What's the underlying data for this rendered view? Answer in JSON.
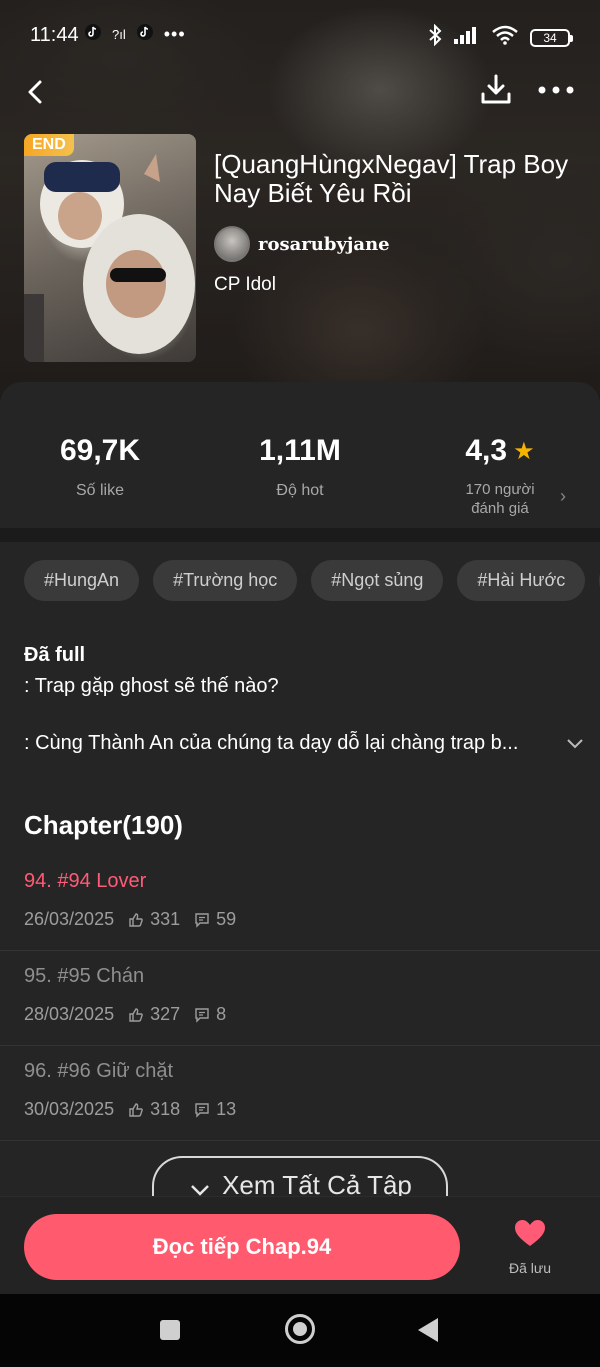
{
  "status": {
    "time": "11:44",
    "left_icons": [
      "tiktok-icon",
      "signal-question-icon",
      "tiktok-icon",
      "more-dots-icon"
    ],
    "right_icons": [
      "bluetooth-icon",
      "signal-icon",
      "wifi-icon"
    ],
    "battery": "34"
  },
  "cover": {
    "badge": "END"
  },
  "story": {
    "title": "[QuangHùngxNegav] Trap Boy Nay Biết Yêu Rồi",
    "author": "rosarubyjane",
    "category": "CP Idol"
  },
  "stats": {
    "likes_value": "69,7K",
    "likes_label": "Số like",
    "hot_value": "1,11M",
    "hot_label": "Độ hot",
    "rating_value": "4,3",
    "rating_sub_line1": "170 người",
    "rating_sub_line2": "đánh giá"
  },
  "tags": [
    "#HungAn",
    "#Trường học",
    "#Ngọt sủng",
    "#Hài Hước"
  ],
  "description": {
    "title": "Đã full",
    "line1": ": Trap gặp ghost sẽ thế nào?",
    "line2": ": Cùng Thành An của chúng ta dạy dỗ lại chàng trap b..."
  },
  "chapter_heading": "Chapter(190)",
  "chapters": [
    {
      "title": "94. #94 Lover",
      "date": "26/03/2025",
      "likes": "331",
      "comments": "59",
      "active": true
    },
    {
      "title": "95. #95 Chán",
      "date": "28/03/2025",
      "likes": "327",
      "comments": "8",
      "active": false
    },
    {
      "title": "96. #96 Giữ chặt",
      "date": "30/03/2025",
      "likes": "318",
      "comments": "13",
      "active": false
    }
  ],
  "see_all_label": "Xem Tất Cả Tập",
  "read_button": "Đọc tiếp Chap.94",
  "saved_label": "Đã lưu",
  "colors": {
    "accent": "#ff5a6e",
    "active_chapter": "#ff5a76",
    "star": "#f5b301",
    "panel": "#252525"
  }
}
